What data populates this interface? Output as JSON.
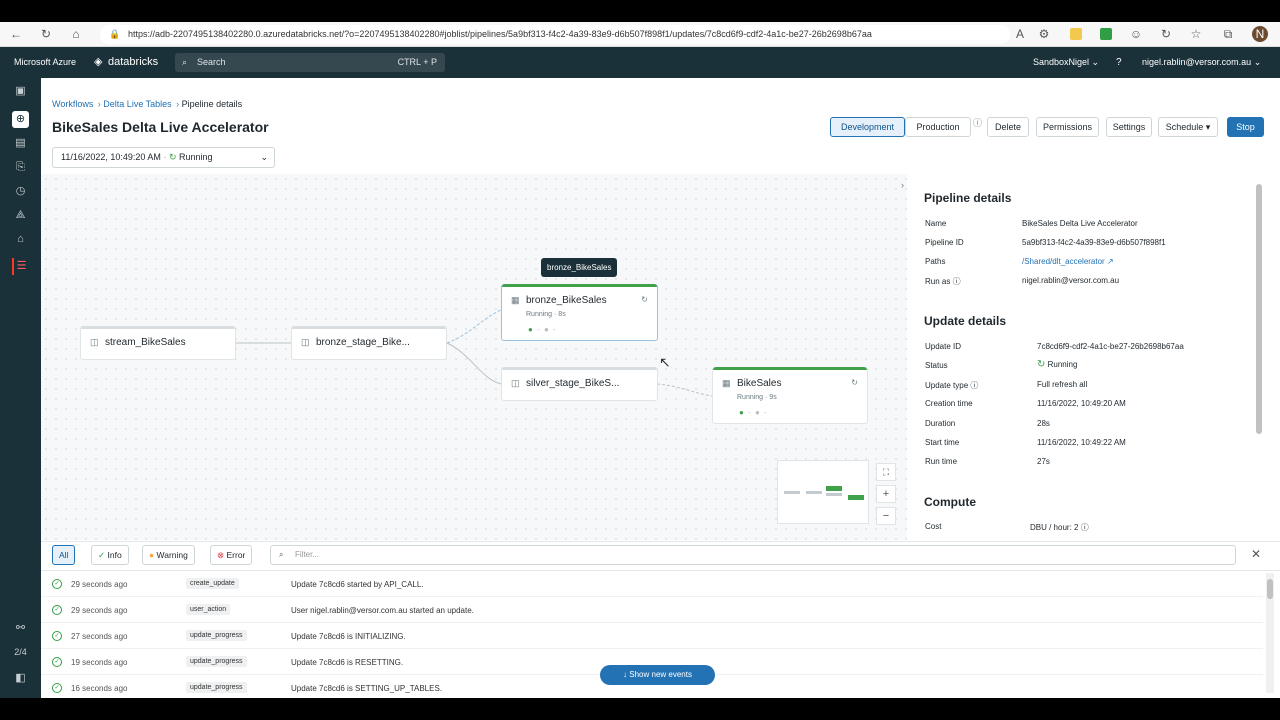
{
  "browser": {
    "url": "https://adb-2207495138402280.0.azuredatabricks.net/?o=2207495138402280#joblist/pipelines/5a9bf313-f4c2-4a39-83e9-d6b507f898f1/updates/7c8cd6f9-cdf2-4a1c-be27-26b2698b67aa"
  },
  "appbar": {
    "brand_azure": "Microsoft Azure",
    "brand_databricks": "databricks",
    "search_placeholder": "Search",
    "search_shortcut": "CTRL + P",
    "workspace": "SandboxNigel",
    "user": "nigel.rablin@versor.com.au"
  },
  "leftrail": {
    "page_counter": "2/4"
  },
  "breadcrumb": {
    "item1": "Workflows",
    "item2": "Delta Live Tables",
    "item3": "Pipeline details"
  },
  "header": {
    "title": "BikeSales Delta Live Accelerator",
    "btn_development": "Development",
    "btn_production": "Production",
    "btn_delete": "Delete",
    "btn_permissions": "Permissions",
    "btn_settings": "Settings",
    "btn_schedule": "Schedule",
    "btn_stop": "Stop"
  },
  "update_selector": {
    "timestamp": "11/16/2022, 10:49:20 AM",
    "status": "Running"
  },
  "graph": {
    "tooltip": "bronze_BikeSales",
    "nodes": {
      "stream": "stream_BikeSales",
      "bronze_stage": "bronze_stage_Bike...",
      "bronze": "bronze_BikeSales",
      "bronze_status": "Running · 8s",
      "silver_stage": "silver_stage_BikeS...",
      "bikesales": "BikeSales",
      "bikesales_status": "Running · 9s"
    }
  },
  "pipeline_details": {
    "heading": "Pipeline details",
    "name_label": "Name",
    "name_value": "BikeSales Delta Live Accelerator",
    "id_label": "Pipeline ID",
    "id_value": "5a9bf313-f4c2-4a39-83e9-d6b507f898f1",
    "paths_label": "Paths",
    "paths_value": "/Shared/dlt_accelerator",
    "runas_label": "Run as",
    "runas_value": "nigel.rablin@versor.com.au"
  },
  "update_details": {
    "heading": "Update details",
    "id_label": "Update ID",
    "id_value": "7c8cd6f9-cdf2-4a1c-be27-26b2698b67aa",
    "status_label": "Status",
    "status_value": "Running",
    "type_label": "Update type",
    "type_value": "Full refresh all",
    "creation_label": "Creation time",
    "creation_value": "11/16/2022, 10:49:20 AM",
    "duration_label": "Duration",
    "duration_value": "28s",
    "start_label": "Start time",
    "start_value": "11/16/2022, 10:49:22 AM",
    "runtime_label": "Run time",
    "runtime_value": "27s"
  },
  "compute": {
    "heading": "Compute",
    "cost_label": "Cost",
    "cost_value": "DBU / hour: 2"
  },
  "log_filters": {
    "all": "All",
    "info": "Info",
    "warning": "Warning",
    "error": "Error",
    "filter_placeholder": "Filter..."
  },
  "events": [
    {
      "time": "29 seconds ago",
      "type": "create_update",
      "message": "Update 7c8cd6 started by API_CALL."
    },
    {
      "time": "29 seconds ago",
      "type": "user_action",
      "message": "User nigel.rablin@versor.com.au started an update."
    },
    {
      "time": "27 seconds ago",
      "type": "update_progress",
      "message": "Update 7c8cd6 is INITIALIZING."
    },
    {
      "time": "19 seconds ago",
      "type": "update_progress",
      "message": "Update 7c8cd6 is RESETTING."
    },
    {
      "time": "16 seconds ago",
      "type": "update_progress",
      "message": "Update 7c8cd6 is SETTING_UP_TABLES."
    }
  ],
  "show_new_events": "Show new events",
  "colors": {
    "accent": "#2272b4",
    "success": "#3fa14a",
    "appbar": "#1b3139"
  }
}
